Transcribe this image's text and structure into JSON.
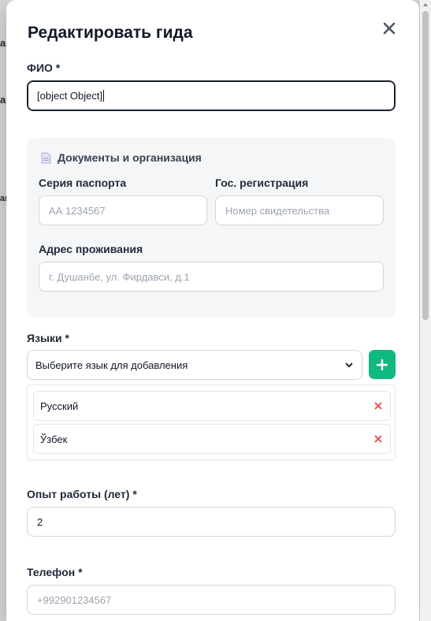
{
  "background": {
    "fragments": [
      "а",
      "а",
      "ан"
    ]
  },
  "modal": {
    "title": "Редактировать гида",
    "close_icon": "close-icon",
    "name_field": {
      "label": "ФИО *",
      "value": "[object Object]"
    },
    "documents": {
      "heading": "Документы и организация",
      "icon": "document-icon",
      "passport": {
        "label": "Серия паспорта",
        "placeholder": "АА 1234567"
      },
      "registration": {
        "label": "Гос. регистрация",
        "placeholder": "Номер свидетельства"
      },
      "address": {
        "label": "Адрес проживания",
        "placeholder": "г. Душанбе, ул. Фирдавси, д.1"
      }
    },
    "languages": {
      "label": "Языки *",
      "select_value": "Выберите язык для добавления",
      "add_icon": "plus-icon",
      "items": [
        {
          "name": "Русский"
        },
        {
          "name": "Ўзбек"
        }
      ]
    },
    "experience": {
      "label": "Опыт работы (лет) *",
      "value": "2"
    },
    "phone": {
      "label": "Телефон *",
      "placeholder": "+992901234567"
    }
  },
  "colors": {
    "accent_green": "#10b981",
    "remove_red": "#ef4444",
    "panel_bg": "#f5f6f8"
  }
}
